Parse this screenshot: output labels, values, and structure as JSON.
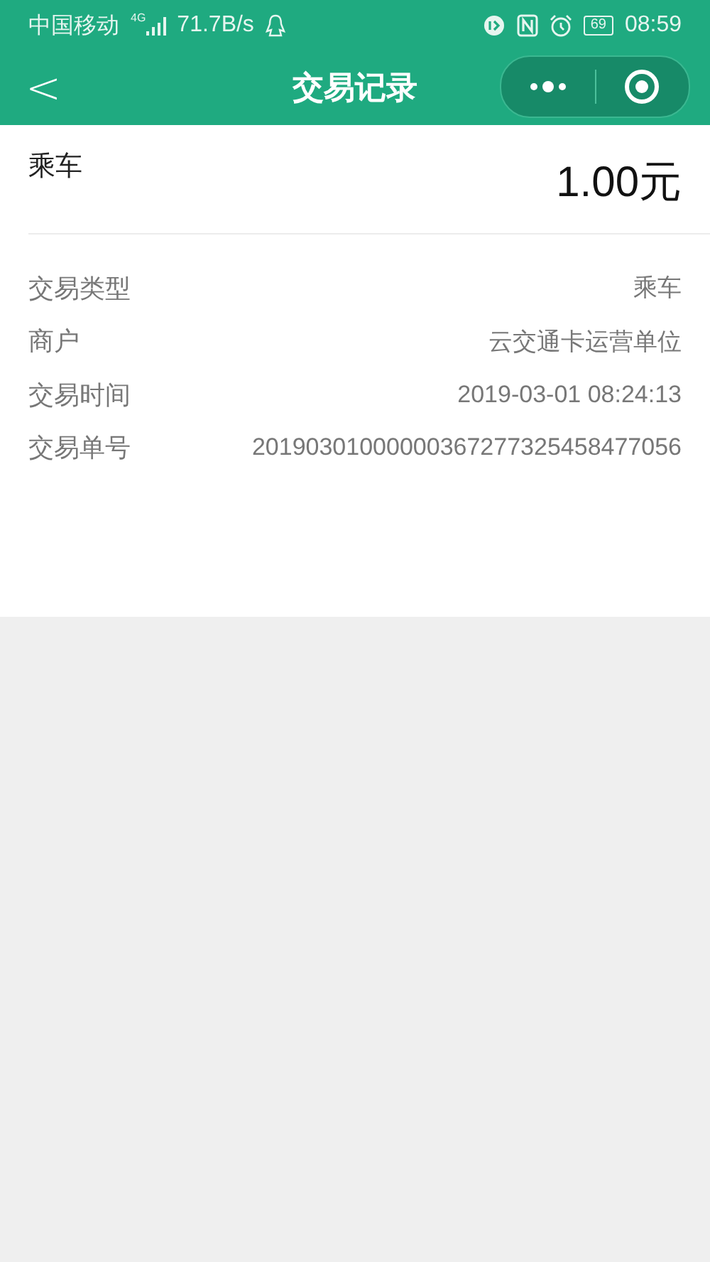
{
  "status_bar": {
    "carrier": "中国移动",
    "network": "4G",
    "speed": "71.7B/s",
    "battery": "69",
    "time": "08:59"
  },
  "nav": {
    "back": "<",
    "title": "交易记录"
  },
  "summary": {
    "type": "乘车",
    "amount": "1.00元"
  },
  "details": [
    {
      "label": "交易类型",
      "value": "乘车"
    },
    {
      "label": "商户",
      "value": "云交通卡运营单位"
    },
    {
      "label": "交易时间",
      "value": "2019-03-01 08:24:13"
    },
    {
      "label": "交易单号",
      "value": "20190301000000367277325458477056"
    }
  ]
}
